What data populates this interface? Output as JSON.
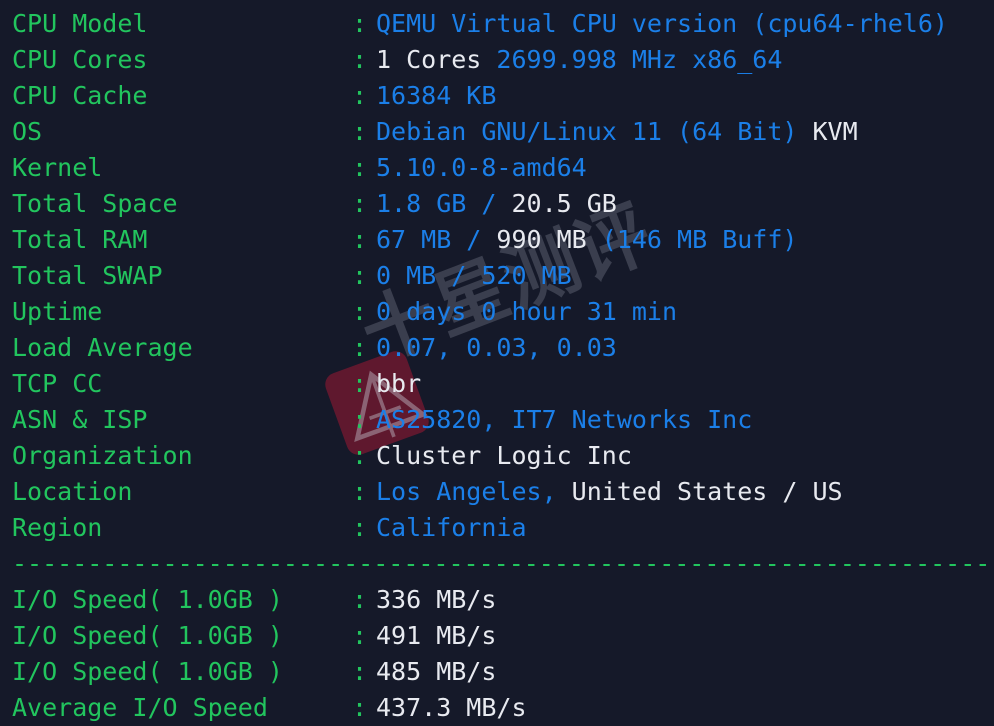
{
  "terminal": {
    "background_color": "#151929",
    "label_color": "#22c55e",
    "value_blue": "#1b7fe8",
    "value_white": "#e8eaf0",
    "separator": "----------------------------------------------------------------------",
    "colon": ":"
  },
  "watermark": {
    "text": "十星测评",
    "badge_color": "#8c1932",
    "icon": "triangle-logo-icon"
  },
  "system_info": [
    {
      "label": "CPU Model",
      "segments": [
        {
          "text": "QEMU Virtual CPU version (cpu64-rhel6)",
          "color": "blue"
        }
      ]
    },
    {
      "label": "CPU Cores",
      "segments": [
        {
          "text": "1 Cores ",
          "color": "white"
        },
        {
          "text": "2699.998 MHz x86_64",
          "color": "blue"
        }
      ]
    },
    {
      "label": "CPU Cache",
      "segments": [
        {
          "text": "16384 KB",
          "color": "blue"
        }
      ]
    },
    {
      "label": "OS",
      "segments": [
        {
          "text": "Debian GNU/Linux 11 (64 Bit) ",
          "color": "blue"
        },
        {
          "text": "KVM",
          "color": "white"
        }
      ]
    },
    {
      "label": "Kernel",
      "segments": [
        {
          "text": "5.10.0-8-amd64",
          "color": "blue"
        }
      ]
    },
    {
      "label": "Total Space",
      "segments": [
        {
          "text": "1.8 GB / ",
          "color": "blue"
        },
        {
          "text": "20.5 GB",
          "color": "white"
        }
      ]
    },
    {
      "label": "Total RAM",
      "segments": [
        {
          "text": "67 MB / ",
          "color": "blue"
        },
        {
          "text": "990 MB ",
          "color": "white"
        },
        {
          "text": "(146 MB Buff)",
          "color": "blue"
        }
      ]
    },
    {
      "label": "Total SWAP",
      "segments": [
        {
          "text": "0 MB / 520 MB",
          "color": "blue"
        }
      ]
    },
    {
      "label": "Uptime",
      "segments": [
        {
          "text": "0 days 0 hour 31 min",
          "color": "blue"
        }
      ]
    },
    {
      "label": "Load Average",
      "segments": [
        {
          "text": "0.07, 0.03, 0.03",
          "color": "blue"
        }
      ]
    },
    {
      "label": "TCP CC",
      "segments": [
        {
          "text": "bbr",
          "color": "white"
        }
      ]
    },
    {
      "label": "ASN & ISP",
      "segments": [
        {
          "text": "AS25820, IT7 Networks Inc",
          "color": "blue"
        }
      ]
    },
    {
      "label": "Organization",
      "segments": [
        {
          "text": "Cluster Logic Inc",
          "color": "white"
        }
      ]
    },
    {
      "label": "Location",
      "segments": [
        {
          "text": "Los Angeles, ",
          "color": "blue"
        },
        {
          "text": "United States / US",
          "color": "white"
        }
      ]
    },
    {
      "label": "Region",
      "segments": [
        {
          "text": "California",
          "color": "blue"
        }
      ]
    }
  ],
  "io_results": [
    {
      "label": "I/O Speed( 1.0GB )",
      "segments": [
        {
          "text": "336 MB/s",
          "color": "white"
        }
      ]
    },
    {
      "label": "I/O Speed( 1.0GB )",
      "segments": [
        {
          "text": "491 MB/s",
          "color": "white"
        }
      ]
    },
    {
      "label": "I/O Speed( 1.0GB )",
      "segments": [
        {
          "text": "485 MB/s",
          "color": "white"
        }
      ]
    },
    {
      "label": "Average I/O Speed",
      "segments": [
        {
          "text": "437.3 MB/s",
          "color": "white"
        }
      ]
    }
  ]
}
